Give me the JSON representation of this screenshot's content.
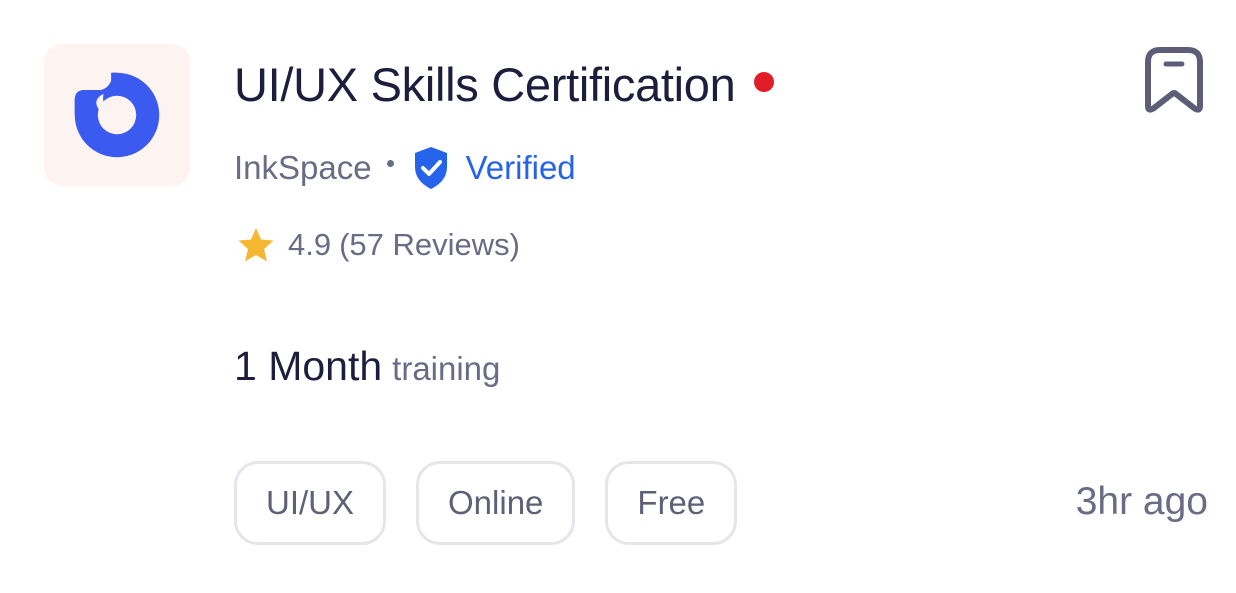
{
  "card": {
    "logo_icon": "brand-logo-icon",
    "title": "UI/UX Skills Certification",
    "status_dot_color": "#e11d2a",
    "bookmark_icon": "bookmark-icon",
    "company": "InkSpace",
    "verified_icon": "verified-shield-icon",
    "verified_label": "Verified",
    "star_icon": "star-icon",
    "rating": "4.9",
    "reviews": "(57 Reviews)",
    "duration": "1 Month",
    "duration_suffix": "training",
    "tags": [
      "UI/UX",
      "Online",
      "Free"
    ],
    "posted": "3hr ago"
  },
  "colors": {
    "accent_blue": "#2563eb",
    "logo_blue": "#3b5bf0",
    "star_yellow": "#f5b731",
    "logo_tile_bg": "#fdf4f1"
  }
}
